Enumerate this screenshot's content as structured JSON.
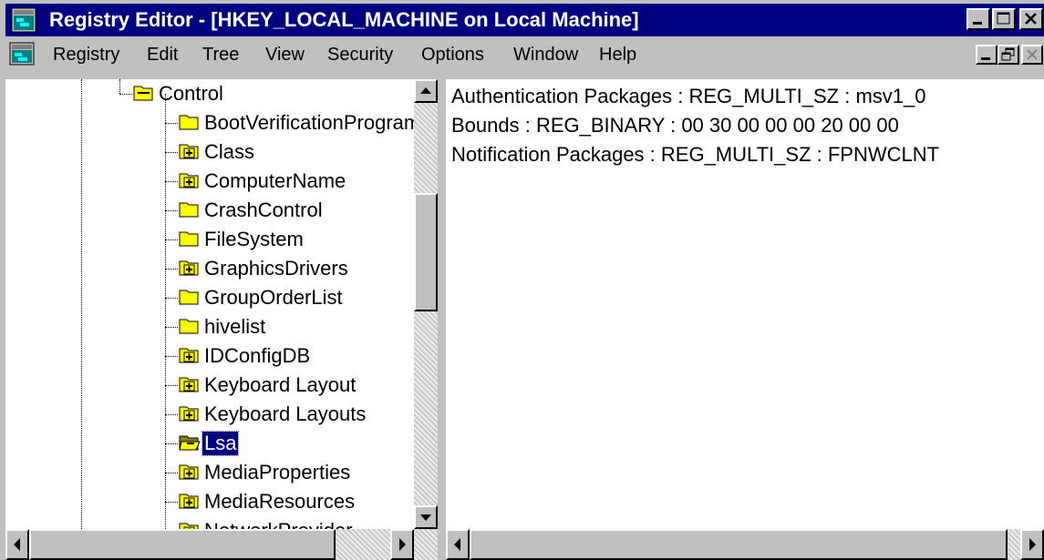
{
  "window": {
    "title": "Registry Editor - [HKEY_LOCAL_MACHINE on Local Machine]",
    "title_bar_color": "#000080",
    "icon": "regedit-icon"
  },
  "menubar": {
    "items": [
      "Registry",
      "Edit",
      "Tree",
      "View",
      "Security",
      "Options",
      "Window",
      "Help"
    ]
  },
  "tree": {
    "parent": {
      "label": "Control",
      "icon": "folder-open-icon",
      "expandable": false
    },
    "children": [
      {
        "label": "BootVerificationProgram",
        "expandable": false,
        "selected": false
      },
      {
        "label": "Class",
        "expandable": true,
        "selected": false
      },
      {
        "label": "ComputerName",
        "expandable": true,
        "selected": false
      },
      {
        "label": "CrashControl",
        "expandable": false,
        "selected": false
      },
      {
        "label": "FileSystem",
        "expandable": false,
        "selected": false
      },
      {
        "label": "GraphicsDrivers",
        "expandable": true,
        "selected": false
      },
      {
        "label": "GroupOrderList",
        "expandable": false,
        "selected": false
      },
      {
        "label": "hivelist",
        "expandable": false,
        "selected": false
      },
      {
        "label": "IDConfigDB",
        "expandable": true,
        "selected": false
      },
      {
        "label": "Keyboard Layout",
        "expandable": true,
        "selected": false
      },
      {
        "label": "Keyboard Layouts",
        "expandable": true,
        "selected": false
      },
      {
        "label": "Lsa",
        "expandable": true,
        "selected": true
      },
      {
        "label": "MediaProperties",
        "expandable": true,
        "selected": false
      },
      {
        "label": "MediaResources",
        "expandable": true,
        "selected": false
      },
      {
        "label": "NetworkProvider",
        "expandable": true,
        "selected": false
      }
    ],
    "selection_color": "#000080"
  },
  "values": [
    {
      "text": "Authentication Packages : REG_MULTI_SZ : msv1_0"
    },
    {
      "text": "Bounds : REG_BINARY : 00 30 00 00 00 20 00 00"
    },
    {
      "text": "Notification Packages : REG_MULTI_SZ : FPNWCLNT"
    }
  ]
}
